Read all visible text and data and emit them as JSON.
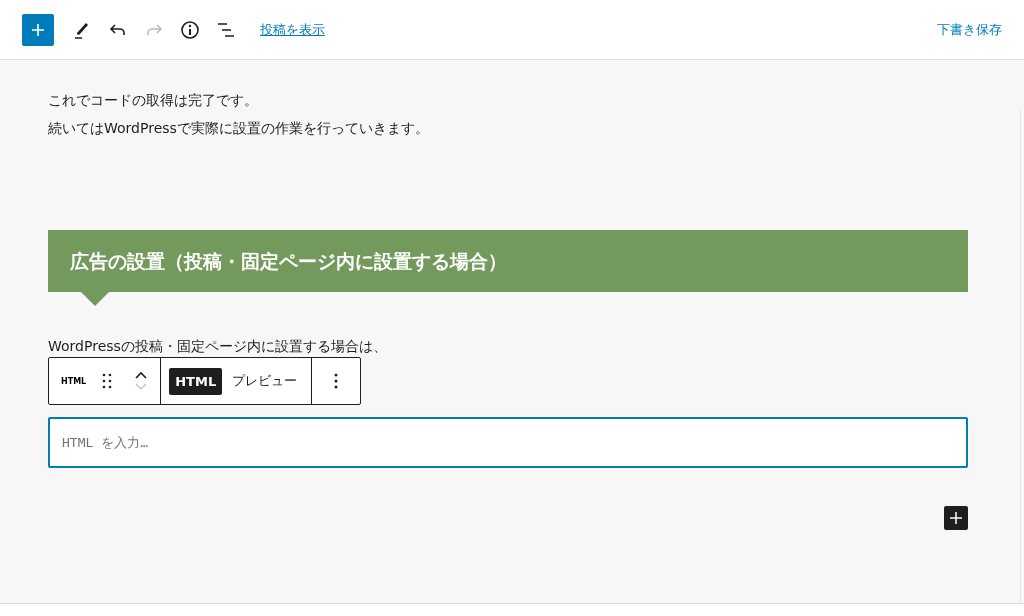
{
  "top_toolbar": {
    "add_button": {
      "selected": true
    },
    "tools": [
      {
        "kind": "edit",
        "disabled": false
      },
      {
        "kind": "undo",
        "disabled": false
      },
      {
        "kind": "redo",
        "disabled": true
      },
      {
        "kind": "info",
        "disabled": false
      },
      {
        "kind": "outline",
        "disabled": false
      }
    ],
    "view_post_link": "投稿を表示",
    "save_draft": "下書き保存"
  },
  "content": {
    "paragraphs": [
      "これでコードの取得は完了です。",
      "続いてはWordPressで実際に設置の作業を行っていきます。"
    ],
    "heading": "広告の設置（投稿・固定ページ内に設置する場合）",
    "paragraph_after": "WordPressの投稿・固定ページ内に設置する場合は、",
    "block_toolbar": {
      "block_type": "HTML",
      "modes": [
        {
          "label": "HTML",
          "selected": true
        },
        {
          "label": "プレビュー",
          "selected": false
        }
      ]
    },
    "html_input": {
      "placeholder": "HTML を入力…"
    }
  }
}
